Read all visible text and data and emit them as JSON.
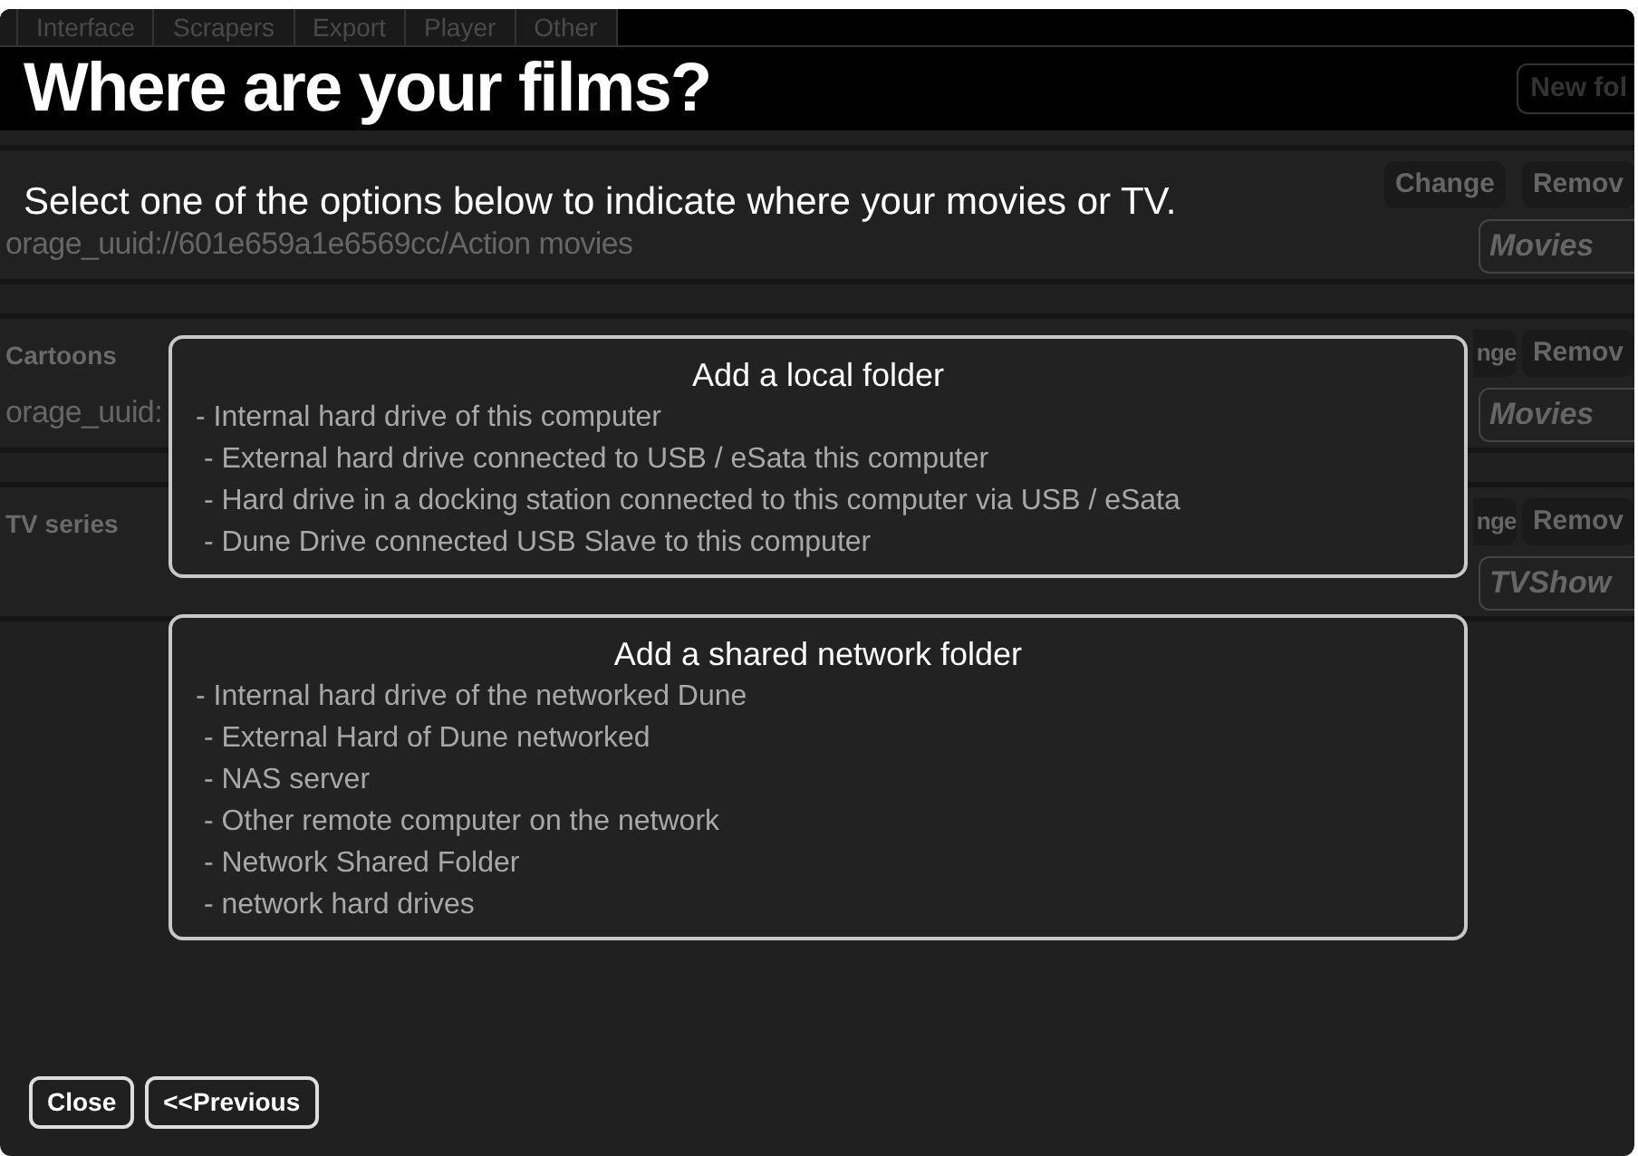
{
  "background": {
    "tabs": [
      {
        "label": "Interface"
      },
      {
        "label": "Scrapers"
      },
      {
        "label": "Export"
      },
      {
        "label": "Player"
      },
      {
        "label": "Other"
      }
    ],
    "new_folder_button": "New fol",
    "rows": [
      {
        "path": "orage_uuid://601e659a1e6569cc/Action movies",
        "buttons": [
          "Change",
          "Remov"
        ],
        "type": "Movies"
      },
      {
        "title": "Cartoons",
        "path": "orage_uuid:",
        "buttons": [
          "nge",
          "Remov"
        ],
        "type": "Movies",
        "first_button_cut": true
      },
      {
        "title": "TV series",
        "buttons": [
          "nge",
          "Remov"
        ],
        "type": "TVShow",
        "first_button_cut": true
      }
    ]
  },
  "dialog": {
    "title": "Where are your films?",
    "subtitle": "Select one of the options below to indicate where your movies or TV.",
    "options": [
      {
        "title": "Add a local folder",
        "items": [
          "- Internal hard drive of this computer",
          " - External hard drive connected to USB / eSata this computer",
          " - Hard drive in a docking station connected to this computer via USB / eSata",
          " - Dune Drive connected USB Slave to this computer"
        ]
      },
      {
        "title": "Add a shared network folder",
        "items": [
          "- Internal hard drive of the networked Dune",
          " - External Hard of Dune networked",
          " - NAS server",
          " - Other remote computer on the network",
          " - Network Shared Folder",
          " - network hard drives"
        ]
      }
    ],
    "buttons": [
      "Close",
      "<<Previous"
    ]
  }
}
